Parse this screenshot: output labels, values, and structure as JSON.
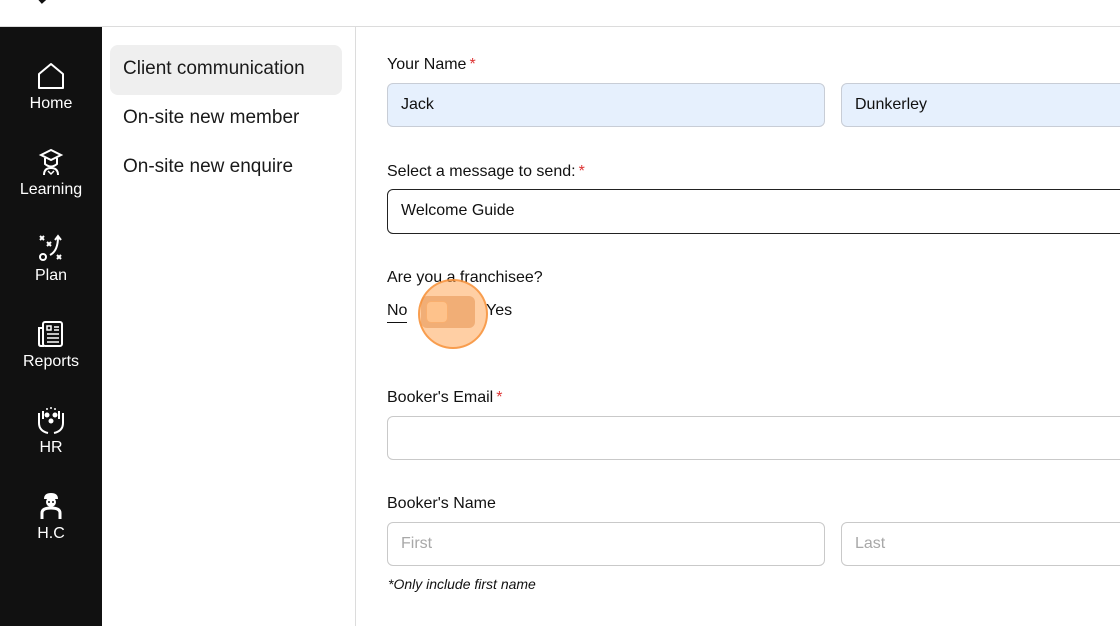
{
  "nav": {
    "items": [
      {
        "label": "Home",
        "icon": "home-icon"
      },
      {
        "label": "Learning",
        "icon": "graduate-icon"
      },
      {
        "label": "Plan",
        "icon": "strategy-icon"
      },
      {
        "label": "Reports",
        "icon": "document-icon"
      },
      {
        "label": "HR",
        "icon": "people-hands-icon"
      },
      {
        "label": "H.C",
        "icon": "person-icon"
      }
    ]
  },
  "subnav": {
    "items": [
      {
        "label": "Client communication",
        "active": true
      },
      {
        "label": "On-site new member",
        "active": false
      },
      {
        "label": "On-site new enquire",
        "active": false
      }
    ]
  },
  "form": {
    "your_name": {
      "label": "Your Name",
      "required_mark": "*",
      "first_value": "Jack",
      "last_value": "Dunkerley"
    },
    "message": {
      "label": "Select a message to send:",
      "required_mark": "*",
      "value": "Welcome Guide"
    },
    "franchisee": {
      "label": "Are you a franchisee?",
      "no_label": "No",
      "yes_label": "Yes",
      "value": "No"
    },
    "booker_email": {
      "label": "Booker's Email",
      "required_mark": "*",
      "value": ""
    },
    "booker_name": {
      "label": "Booker's Name",
      "first_placeholder": "First",
      "last_placeholder": "Last",
      "hint": "*Only include first name"
    }
  },
  "colors": {
    "sidebar_bg": "#111111",
    "active_subnav_bg": "#efefef",
    "filled_input_bg": "#e6f0fd",
    "required": "#dd3333",
    "toggle_accent": "#e0b699"
  }
}
